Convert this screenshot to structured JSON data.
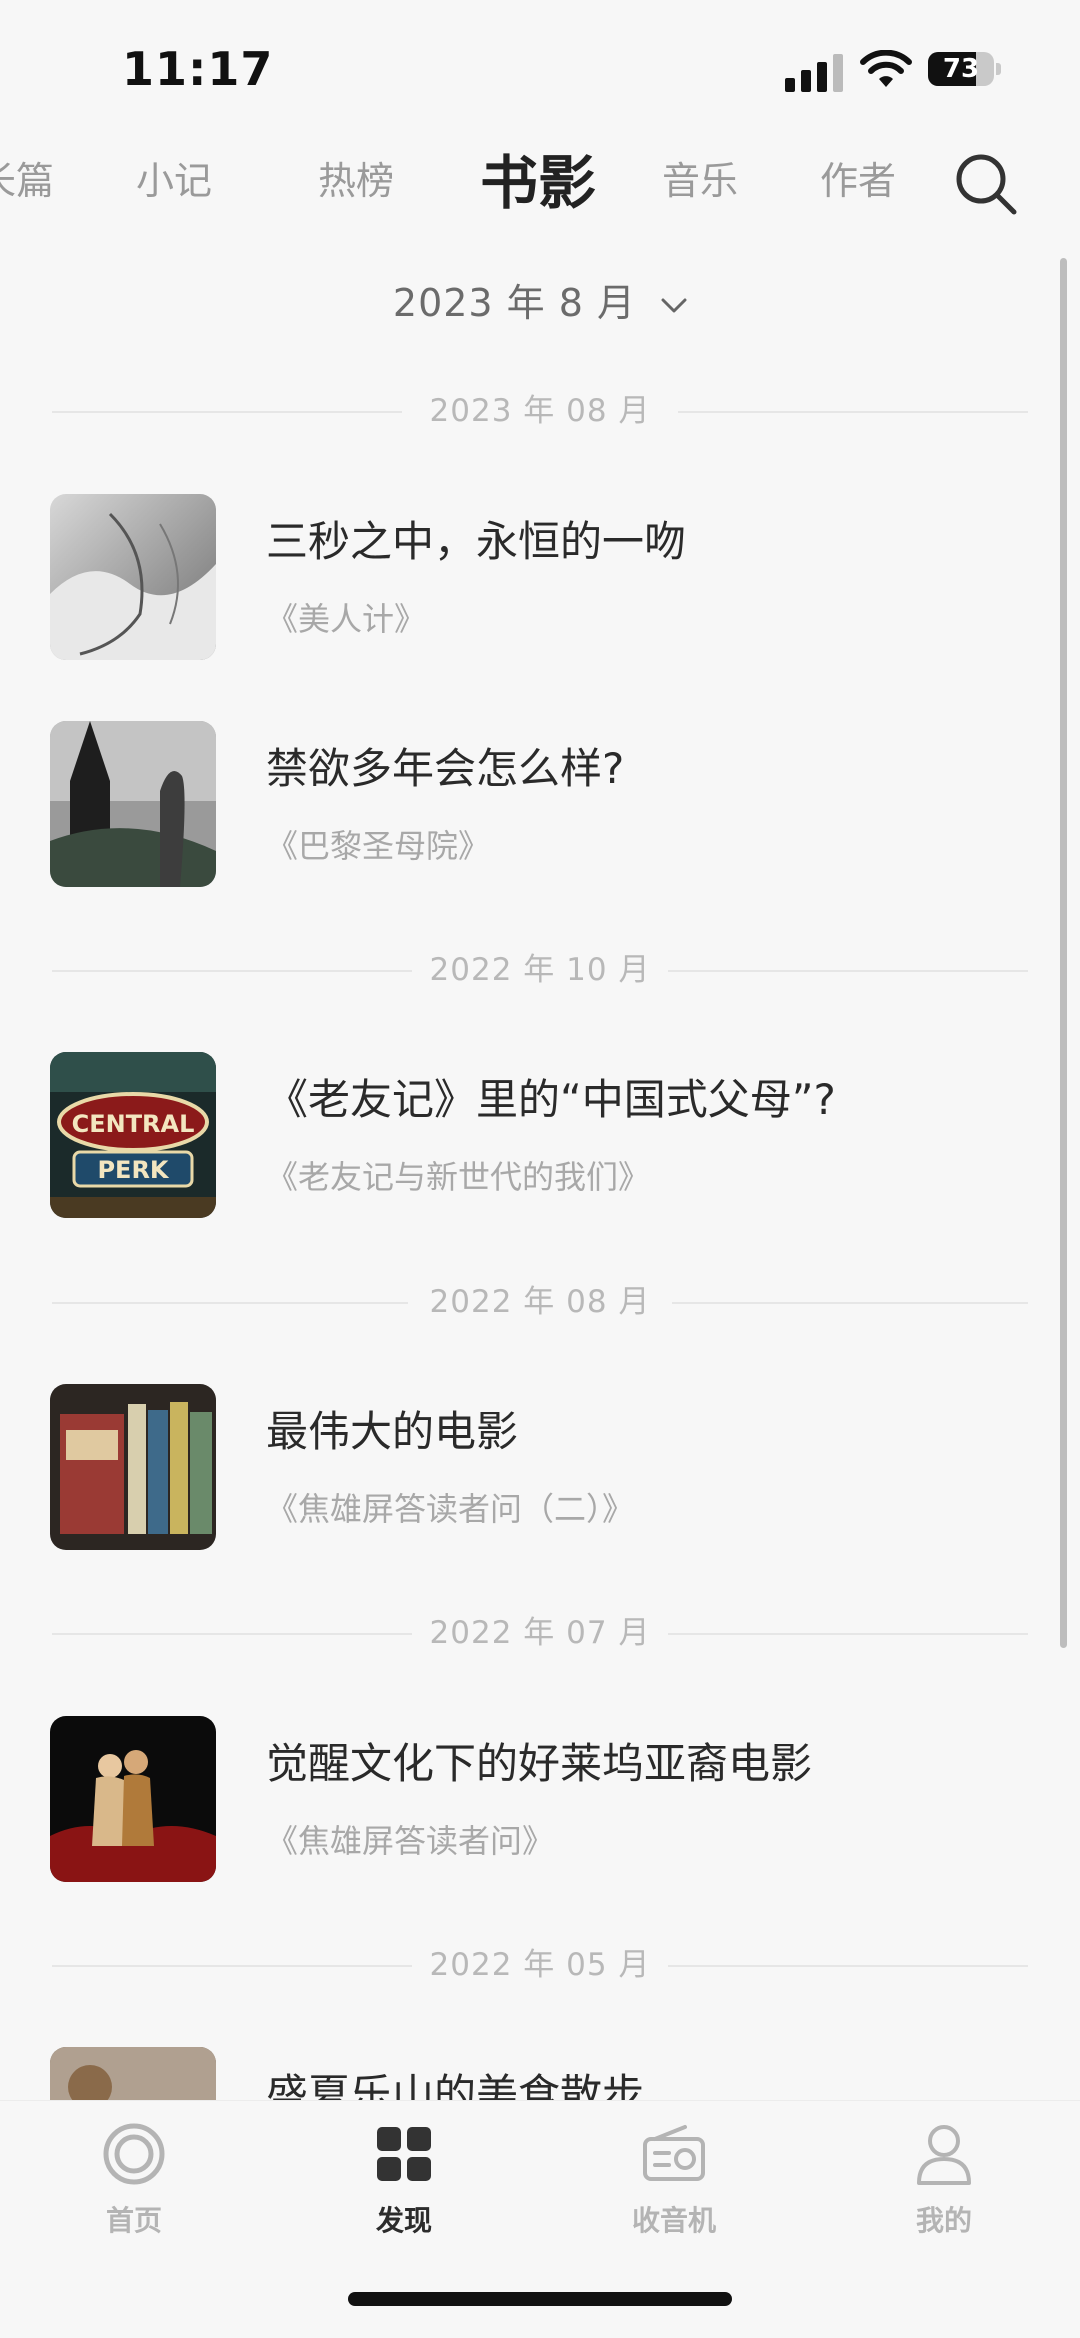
{
  "status_bar": {
    "time": "11:17",
    "battery": "73",
    "battery_level": 0.73
  },
  "top_nav": {
    "tabs": [
      {
        "label": "长篇"
      },
      {
        "label": "小记"
      },
      {
        "label": "热榜"
      },
      {
        "label": "书影"
      },
      {
        "label": "音乐"
      },
      {
        "label": "作者"
      }
    ],
    "active_index": 3,
    "search_icon": "search-icon"
  },
  "date_picker": {
    "label": "2023 年 8 月"
  },
  "sections": [
    {
      "month": "2023 年 08 月",
      "items": [
        {
          "title": "三秒之中，永恒的一吻",
          "source": "《美人计》"
        },
        {
          "title": "禁欲多年会怎么样?",
          "source": "《巴黎圣母院》"
        }
      ]
    },
    {
      "month": "2022 年 10 月",
      "items": [
        {
          "title": "《老友记》里的“中国式父母”?",
          "source": "《老友记与新世代的我们》",
          "thumb_text": [
            "CENTRAL",
            "PERK"
          ]
        }
      ]
    },
    {
      "month": "2022 年 08 月",
      "items": [
        {
          "title": "最伟大的电影",
          "source": "《焦雄屏答读者问（二）》"
        }
      ]
    },
    {
      "month": "2022 年 07 月",
      "items": [
        {
          "title": "觉醒文化下的好莱坞亚裔电影",
          "source": "《焦雄屏答读者问》"
        }
      ]
    },
    {
      "month": "2022 年 05 月",
      "items": [
        {
          "title": "盛夏乐山的美食散步",
          "source": ""
        }
      ]
    }
  ],
  "tab_bar": {
    "items": [
      {
        "label": "首页",
        "icon": "home-icon"
      },
      {
        "label": "发现",
        "icon": "discover-icon"
      },
      {
        "label": "收音机",
        "icon": "radio-icon"
      },
      {
        "label": "我的",
        "icon": "profile-icon"
      }
    ],
    "active_index": 1
  },
  "colors": {
    "background": "#f7f7f7",
    "text_primary": "#2a2a2a",
    "text_muted": "#a8a8a8"
  }
}
